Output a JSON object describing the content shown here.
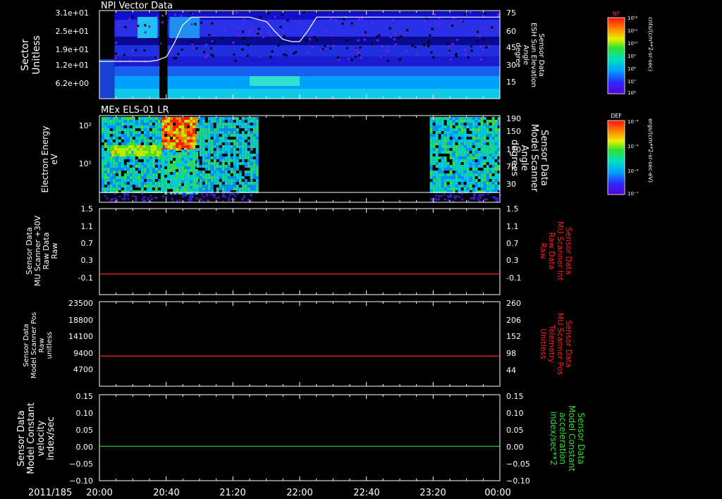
{
  "footer": {
    "date": "2011/185",
    "time_ticks": [
      "20:00",
      "20:40",
      "21:20",
      "22:00",
      "22:40",
      "23:20",
      "00:00"
    ]
  },
  "colors": {
    "background": "#000000",
    "frame": "#ffffff",
    "red_trace": "#ff2020",
    "green_trace": "#33dd33"
  },
  "colorbars": [
    {
      "id": "nf",
      "title": "NF",
      "unit": "cnts/(cm**2-sr-sec)",
      "tick_labels": [
        "10¹²",
        "10¹¹",
        "10¹⁰",
        "10⁹",
        "10⁸",
        "10⁷",
        "10⁶"
      ]
    },
    {
      "id": "def",
      "title": "DEF",
      "unit": "ergs/(cm**2-sr-sec-eV)",
      "tick_labels": [
        "10⁻⁴",
        "10⁻⁵",
        "10⁻⁶",
        "10⁻⁷"
      ]
    }
  ],
  "chart_data": [
    {
      "type": "heatmap",
      "title": "NPI Vector Data",
      "ylabel": [
        "Sector",
        "Unitless"
      ],
      "yticks": [
        "3.1e+01",
        "2.5e+01",
        "1.9e+01",
        "1.2e+01",
        "6.2e+00"
      ],
      "right_label": [
        "Sensor Data",
        "ESH Sun Elevation",
        "Angle",
        "degree"
      ],
      "right_ticks": [
        "75",
        "60",
        "45",
        "30",
        "15"
      ],
      "overlay_line": {
        "name": "ESH Sun Elevation Angle",
        "x_hours": [
          20.0,
          20.33,
          20.5,
          20.58,
          20.67,
          20.75,
          20.83,
          20.92,
          21.0,
          21.5,
          21.67,
          21.75,
          21.83,
          21.92,
          22.0,
          22.08,
          22.17,
          24.0
        ],
        "y_deg": [
          32,
          32,
          32,
          33,
          36,
          48,
          63,
          70,
          70,
          70,
          66,
          58,
          51,
          49,
          49,
          58,
          70,
          70
        ]
      }
    },
    {
      "type": "heatmap",
      "title": "MEx ELS-01 LR",
      "ylabel": [
        "Electron Energy",
        "eV"
      ],
      "yticks": [
        "10²",
        "10¹"
      ],
      "right_label": [
        "Sensor Data",
        "Model Scanner",
        "Angle",
        "degrees"
      ],
      "right_ticks": [
        "190",
        "150",
        "110",
        "70",
        "30"
      ]
    },
    {
      "type": "line",
      "ylabel": [
        "Sensor Data",
        "MU Scanner +30V",
        "Raw Data",
        "Raw"
      ],
      "yticks": [
        "1.5",
        "1.1",
        "0.7",
        "0.3",
        "-0.1"
      ],
      "right_label": [
        "Sensor Data",
        "MU Scanner Int",
        "Raw Data",
        "Raw"
      ],
      "right_ticks": [
        "1.5",
        "1.1",
        "0.7",
        "0.3",
        "-0.1"
      ],
      "ylim": [
        -0.5,
        1.5
      ],
      "series": [
        {
          "x_hours": [
            20.0,
            24.0
          ],
          "values": [
            -0.02,
            -0.02
          ]
        }
      ]
    },
    {
      "type": "line",
      "ylabel": [
        "Sensor Data",
        "Model Scanner Pos",
        "Raw",
        "unitless"
      ],
      "yticks": [
        "23500",
        "18800",
        "14100",
        "9400",
        "4700"
      ],
      "right_label": [
        "Sensor Data",
        "MU Scanner Pos",
        "Telemetry",
        "Unitless"
      ],
      "right_ticks": [
        "260",
        "206",
        "152",
        "98",
        "44"
      ],
      "ylim": [
        0,
        23500
      ],
      "series": [
        {
          "x_hours": [
            20.0,
            24.0
          ],
          "values": [
            8400,
            8400
          ]
        }
      ]
    },
    {
      "type": "line",
      "ylabel": [
        "Sensor Data",
        "Model Constant",
        "velocity",
        "index/sec"
      ],
      "yticks": [
        "0.15",
        "0.10",
        "0.05",
        "0.00",
        "−0.05",
        "−0.10"
      ],
      "right_label": [
        "Sensor Data",
        "Model Constant",
        "acceleration",
        "index/sec**2"
      ],
      "right_ticks": [
        "0.15",
        "0.10",
        "0.05",
        "0.00",
        "−0.05",
        "−0.10"
      ],
      "ylim": [
        -0.1,
        0.15
      ],
      "series": [
        {
          "x_hours": [
            20.0,
            24.0
          ],
          "values": [
            0.0,
            0.0
          ]
        }
      ]
    }
  ]
}
